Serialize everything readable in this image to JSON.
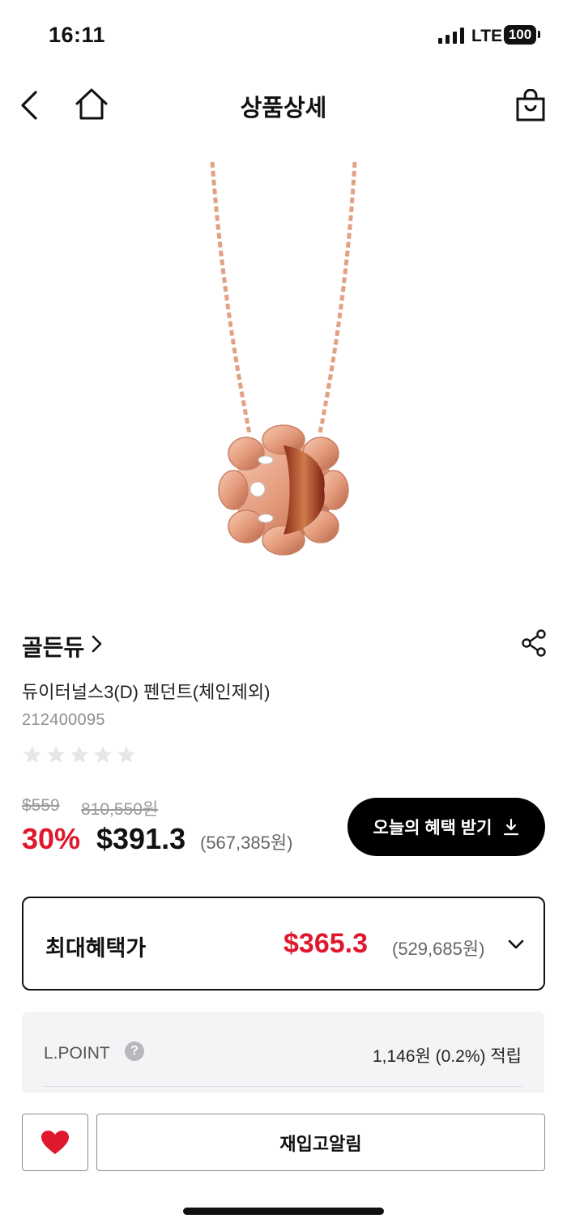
{
  "status_bar": {
    "time": "16:11",
    "network": "LTE",
    "battery": "100",
    "icons": [
      "signal-icon",
      "battery-icon"
    ]
  },
  "header": {
    "title": "상품상세",
    "icons": [
      "back-icon",
      "home-icon",
      "shopping-bag-icon"
    ]
  },
  "product": {
    "image_subject": "rose gold pendant necklace",
    "brand": "골든듀",
    "name": "듀이터널스3(D) 펜던트(체인제외)",
    "code": "212400095",
    "rating": 0,
    "rating_max": 5
  },
  "price": {
    "original_usd": "$559",
    "original_krw": "810,550원",
    "discount": "30%",
    "sale_usd": "$391.3",
    "sale_krw": "(567,385원)",
    "benefit_button": "오늘의 혜택 받기"
  },
  "max_benefit": {
    "label": "최대혜택가",
    "price_usd": "$365.3",
    "price_krw": "(529,685원)"
  },
  "points": {
    "label": "L.POINT",
    "help": "?",
    "value": "1,146원 (0.2%) 적립"
  },
  "bottom_bar": {
    "restock_button": "재입고알림"
  },
  "colors": {
    "accent_red": "#e0182d",
    "button_black": "#000000",
    "gold": "#e8a082"
  }
}
